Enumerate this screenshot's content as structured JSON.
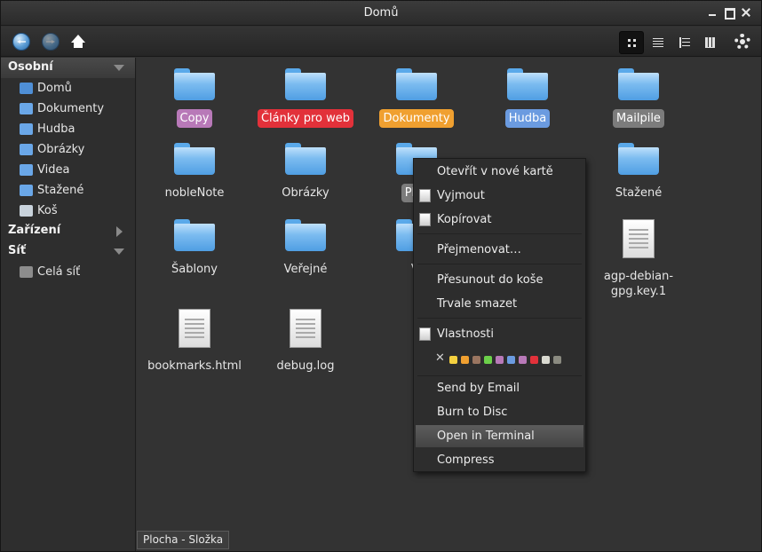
{
  "window": {
    "title": "Domů"
  },
  "toolbar": {
    "back": "back-icon",
    "forward": "forward-icon",
    "home": "home-icon",
    "views": [
      "icon-view",
      "list-view",
      "tree-view",
      "column-view"
    ],
    "settings": "gear-icon"
  },
  "sidebar": {
    "sections": {
      "personal": "Osobní",
      "devices": "Zařízení",
      "network": "Síť"
    },
    "personal_items": [
      {
        "label": "Domů",
        "icon": "home-folder-icon",
        "color": "#4f8fd6"
      },
      {
        "label": "Dokumenty",
        "icon": "documents-icon",
        "color": "#6aa7e8"
      },
      {
        "label": "Hudba",
        "icon": "music-icon",
        "color": "#6aa7e8"
      },
      {
        "label": "Obrázky",
        "icon": "pictures-icon",
        "color": "#6aa7e8"
      },
      {
        "label": "Videa",
        "icon": "videos-icon",
        "color": "#6aa7e8"
      },
      {
        "label": "Stažené",
        "icon": "downloads-icon",
        "color": "#6aa7e8"
      },
      {
        "label": "Koš",
        "icon": "trash-icon",
        "color": "#c9d3dc"
      }
    ],
    "network_items": [
      {
        "label": "Celá síť",
        "icon": "network-icon",
        "color": "#8c8c8c"
      }
    ]
  },
  "files": [
    {
      "name": "Copy",
      "kind": "folder",
      "tag": "#b879b8"
    },
    {
      "name": "Články pro web",
      "kind": "folder",
      "tag": "#e2313a"
    },
    {
      "name": "Dokumenty",
      "kind": "folder",
      "tag": "#f0a030"
    },
    {
      "name": "Hudba",
      "kind": "folder",
      "tag": "#6b9be0"
    },
    {
      "name": "Mailpile",
      "kind": "folder",
      "tag": "#7c7c7c"
    },
    {
      "name": "nobleNote",
      "kind": "folder"
    },
    {
      "name": "Obrázky",
      "kind": "folder"
    },
    {
      "name": "Ploc",
      "kind": "folder",
      "tag": "#7c7c7c"
    },
    {
      "name": "Stažené",
      "kind": "folder"
    },
    {
      "name": "Šablony",
      "kind": "folder"
    },
    {
      "name": "Veřejné",
      "kind": "folder"
    },
    {
      "name": "Vi",
      "kind": "folder"
    },
    {
      "name": "agp-debian-gpg.key.1",
      "kind": "file",
      "line1": "agp-debian-",
      "line2": "gpg.key.1"
    },
    {
      "name": "bookmarks.html",
      "kind": "file"
    },
    {
      "name": "debug.log",
      "kind": "file"
    }
  ],
  "status": "Plocha - Složka",
  "context_menu": {
    "open_tab": "Otevřít v nové kartě",
    "cut": "Vyjmout",
    "copy": "Kopírovat",
    "rename": "Přejmenovat…",
    "trash": "Přesunout do koše",
    "delete": "Trvale smazet",
    "properties": "Vlastnosti",
    "tag_colors": [
      "#f4d03f",
      "#f0a030",
      "#9a7560",
      "#6cd04a",
      "#b879b8",
      "#6b9be0",
      "#b879b8",
      "#e2313a",
      "#d9d9d0",
      "#8a8a80"
    ],
    "send_email": "Send by Email",
    "burn": "Burn to Disc",
    "terminal": "Open in Terminal",
    "compress": "Compress"
  }
}
